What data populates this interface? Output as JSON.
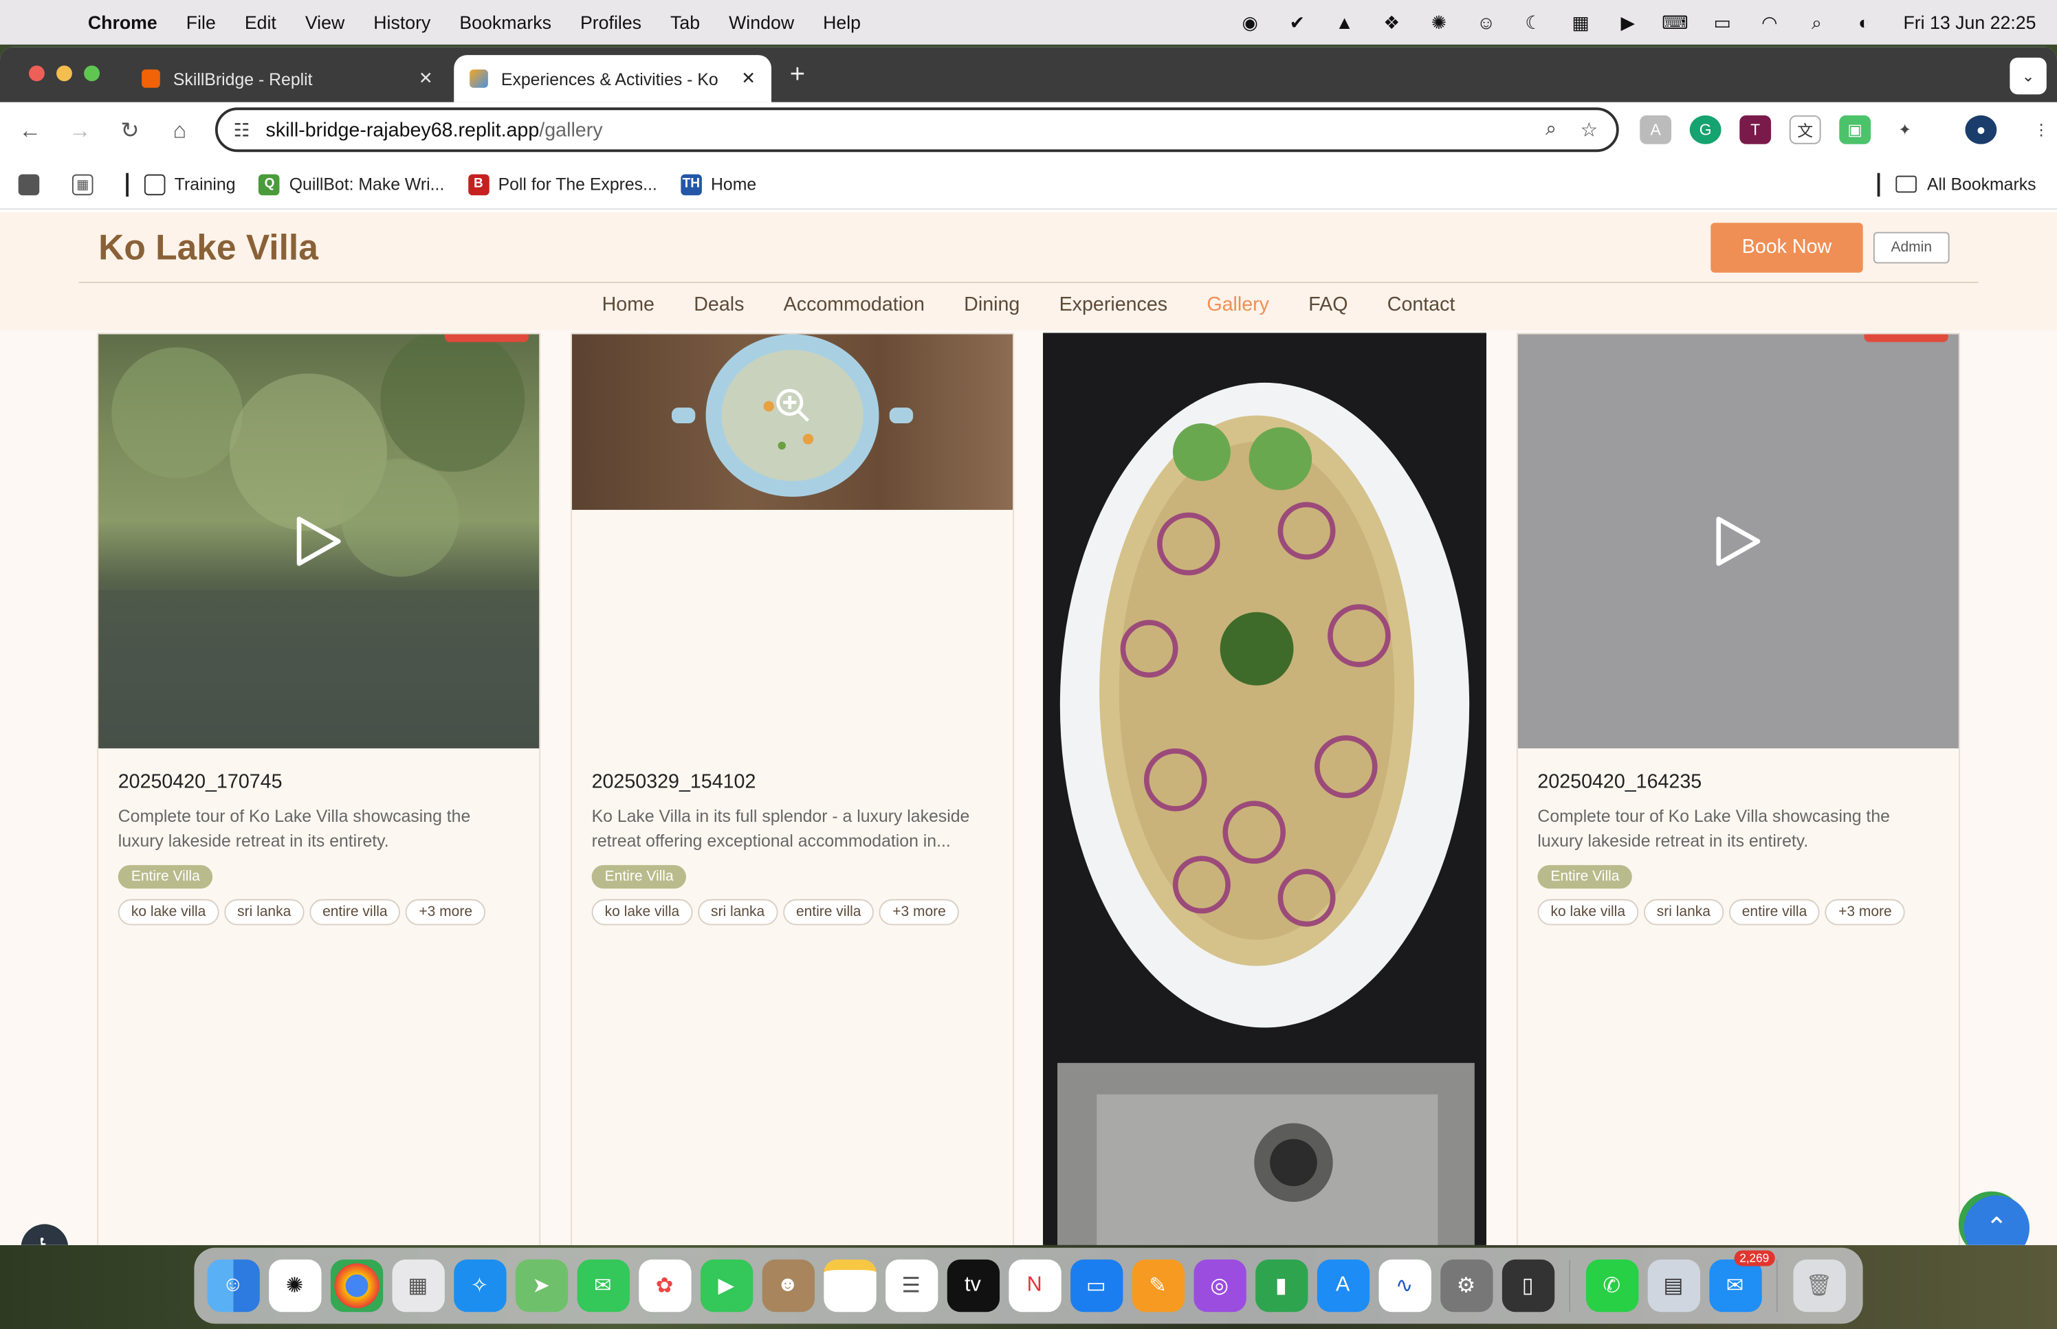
{
  "menubar": {
    "app": "Chrome",
    "menus": [
      "File",
      "Edit",
      "View",
      "History",
      "Bookmarks",
      "Profiles",
      "Tab",
      "Window",
      "Help"
    ],
    "clock": "Fri 13 Jun  22:25"
  },
  "browser": {
    "tabs": [
      {
        "title": "SkillBridge - Replit",
        "active": false
      },
      {
        "title": "Experiences & Activities - Ko",
        "active": true
      }
    ],
    "url_host": "skill-bridge-rajabey68.replit.app",
    "url_path": "/gallery",
    "bookmarks": [
      "Training",
      "QuillBot: Make Wri...",
      "Poll for The Expres...",
      "Home"
    ],
    "all_bookmarks": "All Bookmarks"
  },
  "site": {
    "logo": "Ko Lake Villa",
    "book_now": "Book Now",
    "admin": "Admin",
    "nav": [
      "Home",
      "Deals",
      "Accommodation",
      "Dining",
      "Experiences",
      "Gallery",
      "FAQ",
      "Contact"
    ],
    "active_nav": "Gallery"
  },
  "gallery": [
    {
      "title": "20250420_170745",
      "description": "Complete tour of Ko Lake Villa showcasing the luxury lakeside retreat in its entirety.",
      "category": "Entire Villa",
      "tags": [
        "ko lake villa",
        "sri lanka",
        "entire villa",
        "+3 more"
      ],
      "media": "video"
    },
    {
      "title": "20250329_154102",
      "description": "Ko Lake Villa in its full splendor - a luxury lakeside retreat offering exceptional accommodation in...",
      "category": "Entire Villa",
      "tags": [
        "ko lake villa",
        "sri lanka",
        "entire villa",
        "+3 more"
      ],
      "media": "image"
    },
    {
      "title": "",
      "description": "",
      "category": "",
      "tags": [],
      "media": "image"
    },
    {
      "title": "20250420_164235",
      "description": "Complete tour of Ko Lake Villa showcasing the luxury lakeside retreat in its entirety.",
      "category": "Entire Villa",
      "tags": [
        "ko lake villa",
        "sri lanka",
        "entire villa",
        "+3 more"
      ],
      "media": "video"
    }
  ],
  "dock": {
    "mail_badge": "2,269"
  },
  "colors": {
    "accent": "#f08f55",
    "brand": "#8a6137",
    "category_badge": "#b9bb8c"
  }
}
